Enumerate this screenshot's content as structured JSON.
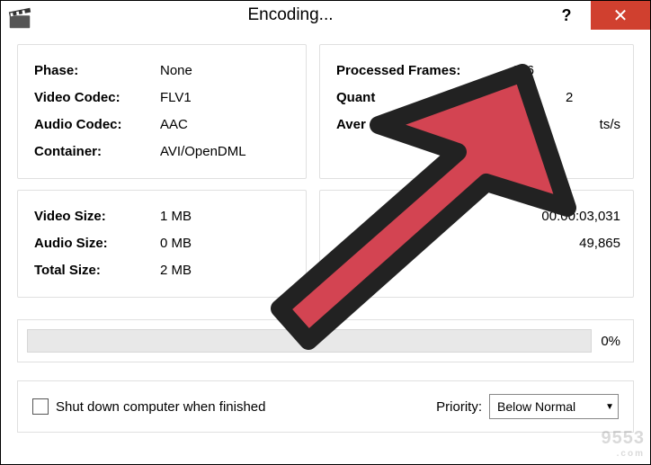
{
  "window": {
    "title": "Encoding...",
    "help_symbol": "?",
    "close_symbol": "✕"
  },
  "panels": {
    "codec": {
      "phase_label": "Phase:",
      "phase_value": "None",
      "vcodec_label": "Video Codec:",
      "vcodec_value": "FLV1",
      "acodec_label": "Audio Codec:",
      "acodec_value": "AAC",
      "container_label": "Container:",
      "container_value": "AVI/OpenDML"
    },
    "frames": {
      "processed_label": "Processed Frames:",
      "processed_value": "146",
      "quant_label": "Quant",
      "quant_value": "2",
      "bitrate_label": "Aver",
      "bitrate_suffix": "ts/s"
    },
    "size": {
      "vsize_label": "Video Size:",
      "vsize_value": "1 MB",
      "asize_label": "Audio Size:",
      "asize_value": "0 MB",
      "tsize_label": "Total Size:",
      "tsize_value": "2 MB"
    },
    "time": {
      "elapsed_value": "00:00:03,031",
      "remaining_value": "49,865"
    }
  },
  "progress": {
    "percent_text": "0%"
  },
  "footer": {
    "shutdown_label": "Shut down computer when finished",
    "priority_label": "Priority:",
    "priority_value": "Below Normal"
  },
  "watermark": {
    "name": "9553",
    "domain": ".com"
  }
}
